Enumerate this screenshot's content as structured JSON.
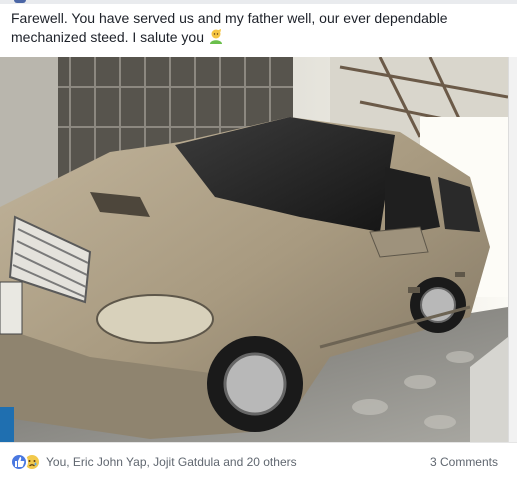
{
  "post": {
    "caption": "Farewell. You have served us and my father well, our ever dependable mechanized steed. I salute you",
    "caption_emoji": "saluting-person-emoji",
    "photo_subject": "car-photo",
    "reactions": {
      "icons": [
        "like-icon",
        "sad-icon"
      ],
      "summary": "You, Eric John Yap, Jojit Gatdula and 20 others"
    },
    "comments_label": "3 Comments"
  },
  "colors": {
    "like_blue": "#4a78e0",
    "sad_yellow": "#f2c94c",
    "meta_text": "#606770"
  }
}
